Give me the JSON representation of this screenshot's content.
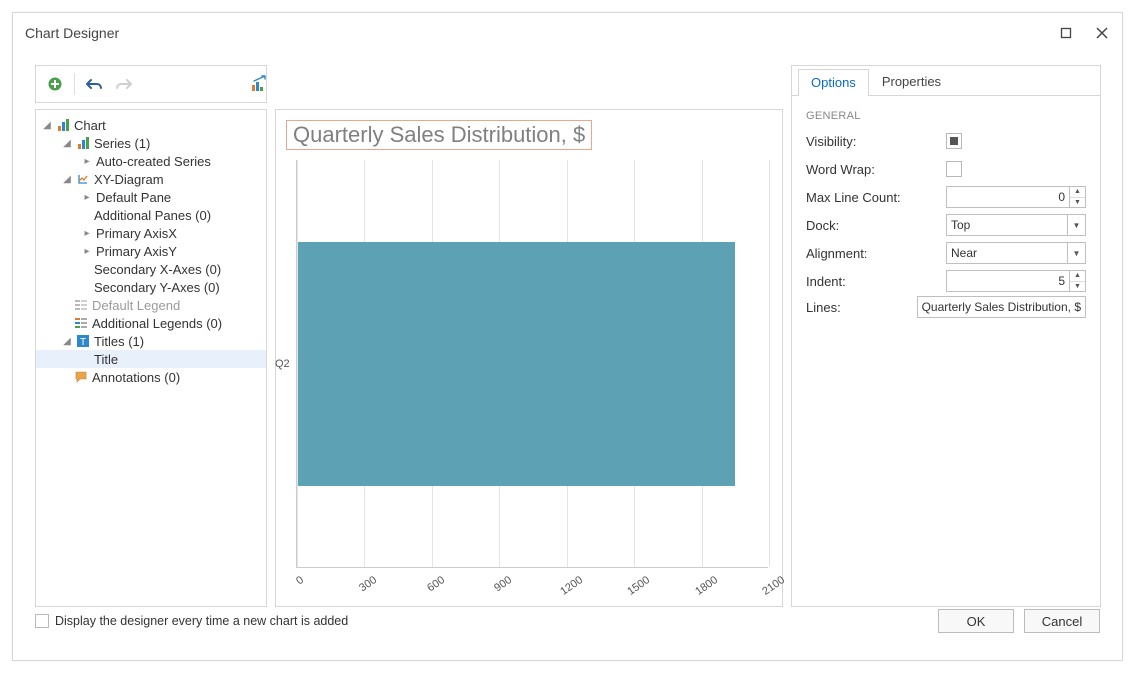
{
  "window": {
    "title": "Chart Designer"
  },
  "tree": {
    "root": "Chart",
    "series": "Series (1)",
    "autoSeries": "Auto-created Series",
    "xyDiagram": "XY-Diagram",
    "defaultPane": "Default Pane",
    "additionalPanes": "Additional Panes (0)",
    "primaryAxisX": "Primary AxisX",
    "primaryAxisY": "Primary AxisY",
    "secX": "Secondary X-Axes (0)",
    "secY": "Secondary Y-Axes (0)",
    "defaultLegend": "Default Legend",
    "additionalLegends": "Additional Legends (0)",
    "titles": "Titles (1)",
    "titleItem": "Title",
    "annotations": "Annotations (0)"
  },
  "chartTitle": "Quarterly Sales Distribution, $",
  "chart_data": {
    "type": "bar",
    "orientation": "horizontal",
    "categories": [
      "Q2"
    ],
    "values": [
      1950
    ],
    "title": "Quarterly Sales Distribution, $",
    "xlabel": "",
    "ylabel": "",
    "xlim": [
      0,
      2100
    ],
    "x_ticks": [
      0,
      300,
      600,
      900,
      1200,
      1500,
      1800,
      2100
    ]
  },
  "tabs": {
    "options": "Options",
    "properties": "Properties"
  },
  "section": "GENERAL",
  "props": {
    "visibility": {
      "label": "Visibility:",
      "checked": true
    },
    "wordWrap": {
      "label": "Word Wrap:",
      "checked": false
    },
    "maxLineCount": {
      "label": "Max Line Count:",
      "value": "0"
    },
    "dock": {
      "label": "Dock:",
      "value": "Top"
    },
    "alignment": {
      "label": "Alignment:",
      "value": "Near"
    },
    "indent": {
      "label": "Indent:",
      "value": "5"
    },
    "lines": {
      "label": "Lines:",
      "value": "Quarterly Sales Distribution, $"
    }
  },
  "footer": {
    "checkboxLabel": "Display the designer every time a new chart is added",
    "ok": "OK",
    "cancel": "Cancel"
  }
}
